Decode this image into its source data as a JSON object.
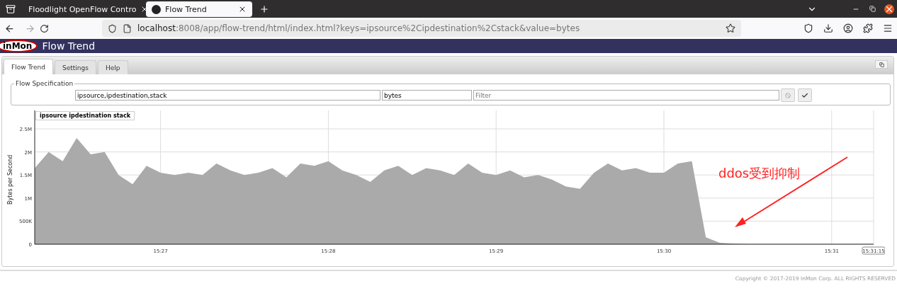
{
  "browser": {
    "tabs": [
      {
        "title": "Floodlight OpenFlow Contro",
        "selected": false
      },
      {
        "title": "Flow Trend",
        "selected": true
      }
    ],
    "url": {
      "host": "localhost",
      "rest": ":8008/app/flow-trend/html/index.html?keys=ipsource%2Cipdestination%2Cstack&value=bytes"
    }
  },
  "header": {
    "logo": "inMon",
    "title": "Flow Trend"
  },
  "tabs": [
    {
      "label": "Flow Trend",
      "selected": true
    },
    {
      "label": "Settings",
      "selected": false
    },
    {
      "label": "Help",
      "selected": false
    }
  ],
  "flow_specification": {
    "legend": "Flow Specification",
    "keys": "ipsource,ipdestination,stack",
    "value": "bytes",
    "filter_placeholder": "Filter"
  },
  "chart": {
    "chart_data": {
      "type": "area",
      "ylabel": "Bytes per Second",
      "categories": [
        null,
        null,
        null,
        null,
        null,
        null,
        null,
        null,
        null,
        "15:27",
        null,
        null,
        null,
        null,
        null,
        null,
        null,
        null,
        null,
        null,
        null,
        "15:28",
        null,
        null,
        null,
        null,
        null,
        null,
        null,
        null,
        null,
        null,
        null,
        "15:29",
        null,
        null,
        null,
        null,
        null,
        null,
        null,
        null,
        null,
        null,
        null,
        "15:30",
        null,
        null,
        null,
        null,
        null,
        null,
        null,
        null,
        null,
        null,
        null,
        "15:31",
        null,
        null,
        "15:31:15"
      ],
      "series": [
        {
          "name": "ipsource ipdestination stack",
          "color": "#aaaaaa",
          "values": [
            1650000,
            2000000,
            1800000,
            2300000,
            1950000,
            2000000,
            1500000,
            1300000,
            1700000,
            1550000,
            1500000,
            1550000,
            1500000,
            1750000,
            1600000,
            1500000,
            1550000,
            1650000,
            1450000,
            1750000,
            1700000,
            1800000,
            1600000,
            1500000,
            1350000,
            1600000,
            1700000,
            1500000,
            1650000,
            1600000,
            1500000,
            1750000,
            1550000,
            1500000,
            1600000,
            1450000,
            1500000,
            1400000,
            1250000,
            1200000,
            1550000,
            1750000,
            1600000,
            1650000,
            1550000,
            1550000,
            1750000,
            1800000,
            150000,
            30000,
            10000,
            0,
            0,
            0,
            0,
            0,
            0,
            0,
            0,
            0,
            0
          ]
        }
      ],
      "ylim": [
        0,
        2900000
      ],
      "grid": true,
      "yticks": [
        {
          "value": 0,
          "label": "0"
        },
        {
          "value": 500000,
          "label": "500K"
        },
        {
          "value": 1000000,
          "label": "1M"
        },
        {
          "value": 1500000,
          "label": "1.5M"
        },
        {
          "value": 2000000,
          "label": "2M"
        },
        {
          "value": 2500000,
          "label": "2.5M"
        }
      ]
    }
  },
  "annotation": {
    "text": "ddos受到抑制"
  },
  "footer": "Copyright © 2017-2019 InMon Corp. ALL RIGHTS RESERVED"
}
